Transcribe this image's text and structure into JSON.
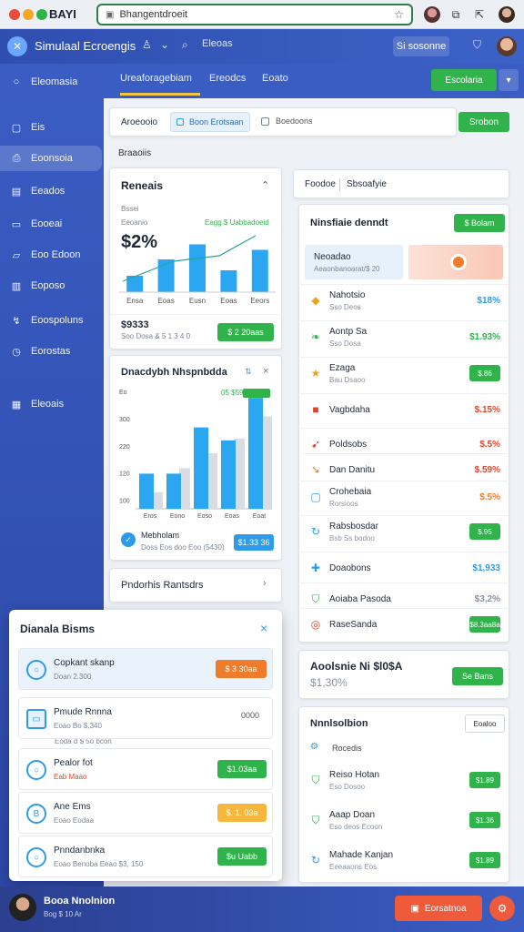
{
  "browser": {
    "brand": "BAYI",
    "url": "Bhangentdroeit",
    "star_icon": "star-icon"
  },
  "header": {
    "app_name": "Simulaal Ecroengis",
    "button_label": "Si sosonne"
  },
  "sidebar": {
    "section": "Eleomasia",
    "items": [
      {
        "label": "Eis",
        "icon": "briefcase-icon"
      },
      {
        "label": "Eoonsoia",
        "icon": "document-icon"
      },
      {
        "label": "Eeados",
        "icon": "calendar-icon"
      },
      {
        "label": "Eooeai",
        "icon": "inbox-icon"
      },
      {
        "label": "Eoo Edoon",
        "icon": "chat-icon"
      },
      {
        "label": "Eoposo",
        "icon": "clipboard-icon"
      },
      {
        "label": "Eoospoluns",
        "icon": "analytics-icon"
      },
      {
        "label": "Eorostas",
        "icon": "clock-icon"
      },
      {
        "label": "Eleoais",
        "icon": "grid-icon"
      }
    ]
  },
  "topbar": {
    "tabs": [
      "Ureaforagebiam",
      "Ereodcs",
      "Eoato"
    ],
    "new_button": "Escolaria"
  },
  "filter": {
    "chip_label": "Aroeooio",
    "chip2_label": "Boon Erotsaan",
    "chip3_label": "Boedoons",
    "button": "Srobon",
    "section_label": "Braaoiis"
  },
  "tabs_right": [
    "Foodoe",
    "Sbsoafyie"
  ],
  "revenue_card": {
    "title": "Reneais",
    "label1": "Bssei",
    "label2": "Eeoanio",
    "big_value": "$2%",
    "trend_label": "Eagg $ Uabbadoeid",
    "categories": [
      "Ensa",
      "Eoas",
      "Eusn",
      "Eoas",
      "Eeors"
    ],
    "values": [
      12,
      24,
      35,
      16,
      31
    ],
    "footer_value": "$9333",
    "footer_sub": "Soo Dosa & 5 1 3 4 0",
    "footer_button": "$ 2 20aas"
  },
  "chart_card": {
    "title": "Dnacdybh Nhspnbdda",
    "legend_badge": "05 $59",
    "y_ticks": [
      "Eo",
      "300",
      "220",
      "120",
      "100"
    ],
    "categories": [
      "Eros",
      "Eono",
      "Eoso",
      "Eoas",
      "Eoat"
    ],
    "footer_title": "Mebholam",
    "footer_sub": "Doss Eos doo Eoo (5430)",
    "footer_button": "$1.33 36"
  },
  "chart_data": {
    "type": "bar",
    "categories": [
      "Eros",
      "Eono",
      "Eoso",
      "Eoas",
      "Eoat"
    ],
    "series": [
      {
        "values": [
          95,
          95,
          220,
          185,
          300
        ]
      },
      {
        "values": [
          45,
          110,
          150,
          190,
          250
        ]
      }
    ],
    "y_ticks": [
      "Eo",
      "300",
      "220",
      "120",
      "100"
    ],
    "ylim": [
      0,
      320
    ]
  },
  "recent_card": {
    "title": "Pndorhis Rantsdrs"
  },
  "right_card": {
    "title": "Ninsfiaie denndt",
    "button": "$ Bolam",
    "banner_title": "Neoadao",
    "banner_sub": "Aeaonbanoarat/$ 20",
    "rows": [
      {
        "icon": "tag-icon",
        "icon_color": "#f0a020",
        "name": "Nahotsio",
        "sub": "Sso Deos",
        "value": "$18%",
        "value_color": "#2e9be8",
        "button": false
      },
      {
        "icon": "leaf-icon",
        "icon_color": "#2fb34a",
        "name": "Aontp Sa",
        "sub": "Sso Dosa",
        "value": "$1.93%",
        "value_color": "#2fb34a",
        "button": false
      },
      {
        "icon": "star-icon",
        "icon_color": "#f0a020",
        "name": "Ezaga",
        "sub": "Bau Dsaoo",
        "value": "$.86",
        "value_color": "#ffffff",
        "button": true
      },
      {
        "icon": "alert-icon",
        "icon_color": "#e0452c",
        "name": "Vagbdaha",
        "sub": "",
        "value": "$.15%",
        "value_color": "#e0452c",
        "button": false
      },
      {
        "icon": "pin-icon",
        "icon_color": "#e0452c",
        "name": "Poldsobs",
        "sub": "",
        "value": "$.5%",
        "value_color": "#e0452c",
        "button": false
      },
      {
        "icon": "lightning-icon",
        "icon_color": "#f07b2a",
        "name": "Dan Danitu",
        "sub": "",
        "value": "$.59%",
        "value_color": "#e0452c",
        "button": false
      },
      {
        "icon": "doc-icon",
        "icon_color": "#2e9be8",
        "name": "Crohebaia",
        "sub": "Rorsioos",
        "value": "$.5%",
        "value_color": "#f07b2a",
        "button": false
      },
      {
        "icon": "refresh-icon",
        "icon_color": "#2e9be8",
        "name": "Rabsbosdar",
        "sub": "Bsb Ss bodoo",
        "value": "$.95",
        "value_color": "#ffffff",
        "button": true
      },
      {
        "icon": "puzzle-icon",
        "icon_color": "#2e9be8",
        "name": "Doaobons",
        "sub": "",
        "value": "$1,933",
        "value_color": "#2e9be8",
        "button": false
      },
      {
        "icon": "shield-icon",
        "icon_color": "#2fb34a",
        "name": "Aoiaba Pasoda",
        "sub": "",
        "value": "$3,2%",
        "value_color": "#8a93a1",
        "button": false
      },
      {
        "icon": "target-icon",
        "icon_color": "#e0452c",
        "name": "RaseSanda",
        "sub": "",
        "value": "$8.3aa8a",
        "value_color": "#ffffff",
        "button": true
      }
    ]
  },
  "goal_card": {
    "title": "Aoolsnie Ni $l0$A",
    "value": "$1,30%",
    "button": "Se Bans"
  },
  "notif_card": {
    "title": "Nnnlsolbion",
    "dropdown": "Eoaloo",
    "filter_label": "Rocedis",
    "items": [
      {
        "name": "Reiso Hotan",
        "sub": "Eso Dosoo",
        "button": "$1.89"
      },
      {
        "name": "Aaap Doan",
        "sub": "Eso deos Ecoon",
        "button": "$1.36"
      },
      {
        "name": "Mahade Kanjan",
        "sub": "Eeeaaons Eos",
        "button": "$1.89"
      }
    ]
  },
  "popup": {
    "title": "Dianala Bisms",
    "items": [
      {
        "name": "Copkant skanp",
        "sub": "Doan 2.300",
        "button": "$ 3 30aa",
        "btn_kind": "orange"
      },
      {
        "name": "Pmude Rnnna",
        "sub": "Eoao Bo $,340",
        "button": "0000",
        "btn_kind": "text"
      },
      {
        "name": "Pealor fot",
        "sub": "Eab Maao",
        "button": "$1.03aa",
        "btn_kind": "green"
      },
      {
        "name": "Ane Ems",
        "sub": "Eoao Eodaa",
        "button": "$. 1. 03a",
        "btn_kind": "yellow"
      },
      {
        "name": "Pnndanbnka",
        "sub": "Eoao Benoba Eeao $3, 150",
        "button": "$u Uabb",
        "btn_kind": "green"
      }
    ],
    "note": "Eoda d $ 5o bcon"
  },
  "footer": {
    "user_name": "Booa Nnolnion",
    "user_sub": "Bog $ 10 Ar",
    "button": "Eorsatnoa"
  }
}
